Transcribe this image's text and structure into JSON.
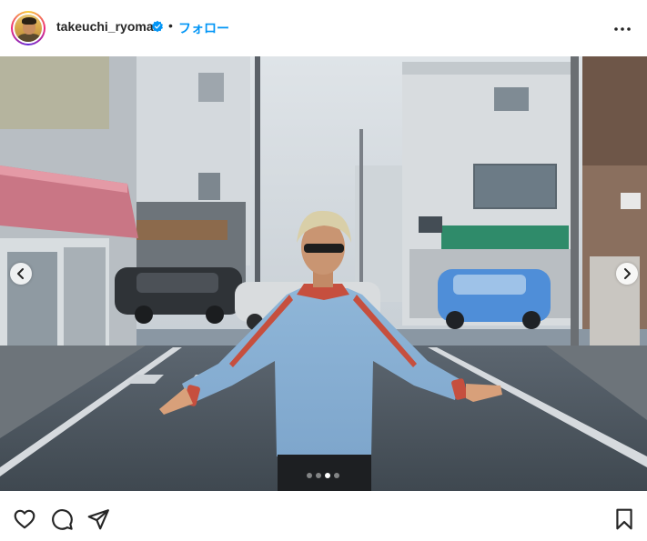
{
  "post": {
    "username": "takeuchi_ryoma",
    "separator": "•",
    "follow_label": "フォロー",
    "verified": true
  },
  "carousel": {
    "slide_count": 4,
    "active_slide": 3
  },
  "icons": {
    "verified": "verified-badge-icon",
    "more": "more-options-icon",
    "prev": "chevron-left-icon",
    "next": "chevron-right-icon",
    "like": "heart-icon",
    "comment": "comment-icon",
    "share": "paper-plane-icon",
    "save": "bookmark-icon"
  },
  "colors": {
    "link": "#0095f6",
    "verified": "#0095f6",
    "text": "#262626"
  }
}
